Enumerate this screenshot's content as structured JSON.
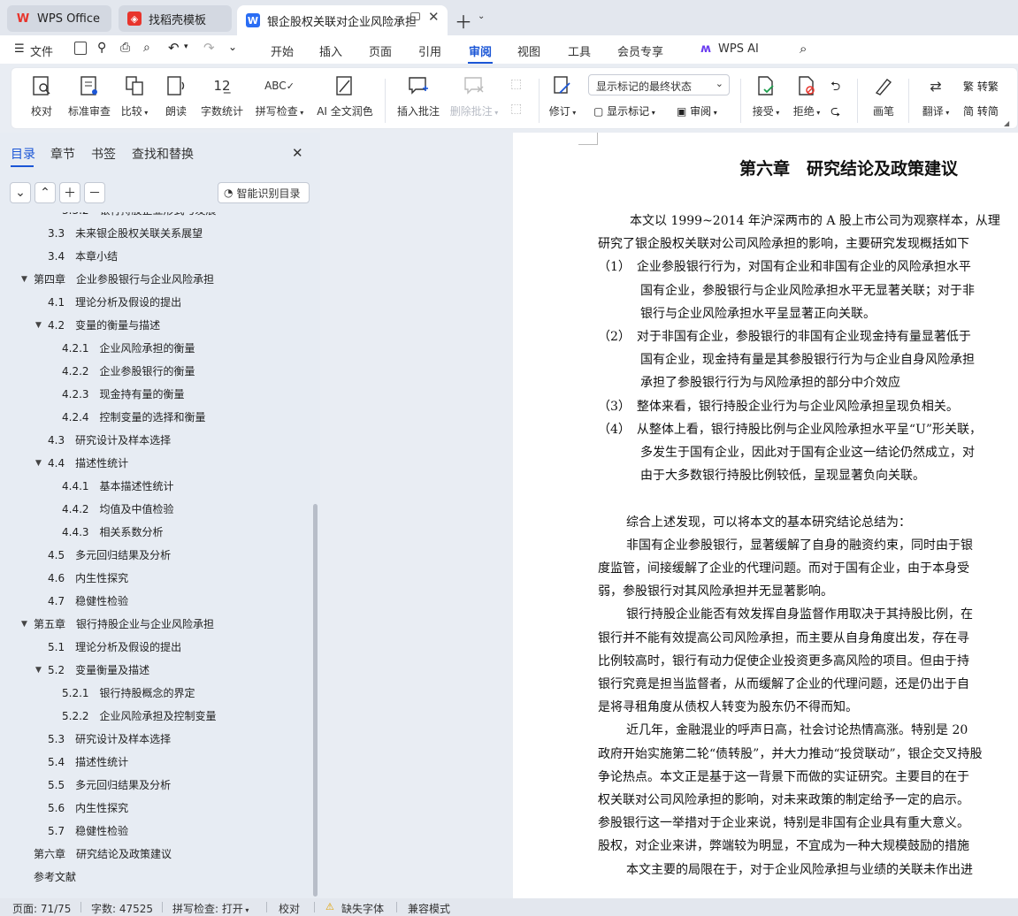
{
  "tabs": {
    "wps_office": "WPS Office",
    "template": "找稻壳模板",
    "document": "银企股权关联对企业风险承担"
  },
  "menu": {
    "file": "文件",
    "items": [
      "开始",
      "插入",
      "页面",
      "引用",
      "审阅",
      "视图",
      "工具",
      "会员专享",
      "WPS AI"
    ],
    "active": "审阅"
  },
  "ribbon": {
    "proofread": "校对",
    "standard_review": "标准审查",
    "compare": "比较",
    "read_aloud": "朗读",
    "word_count": "字数统计",
    "spell_check": "拼写检查",
    "ai_polish": "AI 全文润色",
    "insert_comment": "插入批注",
    "delete_comment": "删除批注",
    "track_changes": "修订",
    "markup_display_select": "显示标记的最终状态",
    "show_markup": "显示标记",
    "review": "审阅",
    "accept": "接受",
    "reject": "拒绝",
    "pen": "画笔",
    "translate": "翻译",
    "to_traditional": "转繁",
    "to_simplified": "转简"
  },
  "panel": {
    "tabs": [
      "目录",
      "章节",
      "书签",
      "查找和替换"
    ],
    "smart_toc": "智能识别目录"
  },
  "toc": [
    {
      "num": "3.3.2",
      "text": "银行持股企业形式与发展",
      "level": 3
    },
    {
      "num": "3.3",
      "text": "未来银企股权关联关系展望",
      "level": 2
    },
    {
      "num": "3.4",
      "text": "本章小结",
      "level": 2
    },
    {
      "num": "第四章",
      "text": "企业参股银行与企业风险承担",
      "level": 1,
      "expanded": true
    },
    {
      "num": "4.1",
      "text": "理论分析及假设的提出",
      "level": 2
    },
    {
      "num": "4.2",
      "text": "变量的衡量与描述",
      "level": 2,
      "expanded": true
    },
    {
      "num": "4.2.1",
      "text": "企业风险承担的衡量",
      "level": 3
    },
    {
      "num": "4.2.2",
      "text": "企业参股银行的衡量",
      "level": 3
    },
    {
      "num": "4.2.3",
      "text": "现金持有量的衡量",
      "level": 3
    },
    {
      "num": "4.2.4",
      "text": "控制变量的选择和衡量",
      "level": 3
    },
    {
      "num": "4.3",
      "text": "研究设计及样本选择",
      "level": 2
    },
    {
      "num": "4.4",
      "text": "描述性统计",
      "level": 2,
      "expanded": true
    },
    {
      "num": "4.4.1",
      "text": "基本描述性统计",
      "level": 3
    },
    {
      "num": "4.4.2",
      "text": "均值及中值检验",
      "level": 3
    },
    {
      "num": "4.4.3",
      "text": "相关系数分析",
      "level": 3
    },
    {
      "num": "4.5",
      "text": "多元回归结果及分析",
      "level": 2
    },
    {
      "num": "4.6",
      "text": "内生性探究",
      "level": 2
    },
    {
      "num": "4.7",
      "text": "稳健性检验",
      "level": 2
    },
    {
      "num": "第五章",
      "text": "银行持股企业与企业风险承担",
      "level": 1,
      "expanded": true
    },
    {
      "num": "5.1",
      "text": "理论分析及假设的提出",
      "level": 2
    },
    {
      "num": "5.2",
      "text": "变量衡量及描述",
      "level": 2,
      "expanded": true
    },
    {
      "num": "5.2.1",
      "text": "银行持股概念的界定",
      "level": 3
    },
    {
      "num": "5.2.2",
      "text": "企业风险承担及控制变量",
      "level": 3
    },
    {
      "num": "5.3",
      "text": "研究设计及样本选择",
      "level": 2
    },
    {
      "num": "5.4",
      "text": "描述性统计",
      "level": 2
    },
    {
      "num": "5.5",
      "text": "多元回归结果及分析",
      "level": 2
    },
    {
      "num": "5.6",
      "text": "内生性探究",
      "level": 2
    },
    {
      "num": "5.7",
      "text": "稳健性检验",
      "level": 2
    },
    {
      "num": "第六章",
      "text": "研究结论及政策建议",
      "level": 1
    },
    {
      "num": "参考文献",
      "text": "",
      "level": 1
    }
  ],
  "document": {
    "chapter_title": "第六章　研究结论及政策建议",
    "lines": [
      {
        "text": "本文以 1999~2014 年沪深两市的 A 股上市公司为观察样本，从理",
        "indent": 36
      },
      {
        "text": "研究了银企股权关联对公司风险承担的影响，主要研究发现概括如下",
        "indent": 0
      },
      {
        "text": "（1）　企业参股银行行为，对国有企业和非国有企业的风险承担水平",
        "indent": 0
      },
      {
        "text": "国有企业，参股银行与企业风险承担水平无显著关联；对于非",
        "indent": 48
      },
      {
        "text": "银行与企业风险承担水平呈显著正向关联。",
        "indent": 48
      },
      {
        "text": "（2）　对于非国有企业，参股银行的非国有企业现金持有量显著低于",
        "indent": 0
      },
      {
        "text": "国有企业，现金持有量是其参股银行行为与企业自身风险承担",
        "indent": 48
      },
      {
        "text": "承担了参股银行行为与风险承担的部分中介效应",
        "indent": 48
      },
      {
        "text": "（3）　整体来看，银行持股企业行为与企业风险承担呈现负相关。",
        "indent": 0
      },
      {
        "text": "（4）　从整体上看，银行持股比例与企业风险承担水平呈“U”形关联，",
        "indent": 0
      },
      {
        "text": "多发生于国有企业，因此对于国有企业这一结论仍然成立，对",
        "indent": 48
      },
      {
        "text": "由于大多数银行持股比例较低，呈现显著负向关联。",
        "indent": 48
      },
      {
        "text": "",
        "indent": 0
      },
      {
        "text": "综合上述发现，可以将本文的基本研究结论总结为：",
        "indent": 32
      },
      {
        "text": "非国有企业参股银行，显著缓解了自身的融资约束，同时由于银",
        "indent": 32
      },
      {
        "text": "度监管，间接缓解了企业的代理问题。而对于国有企业，由于本身受",
        "indent": 0
      },
      {
        "text": "弱，参股银行对其风险承担并无显著影响。",
        "indent": 0
      },
      {
        "text": "银行持股企业能否有效发挥自身监督作用取决于其持股比例，在",
        "indent": 32
      },
      {
        "text": "银行并不能有效提高公司风险承担，而主要从自身角度出发，存在寻",
        "indent": 0
      },
      {
        "text": "比例较高时，银行有动力促使企业投资更多高风险的项目。但由于持",
        "indent": 0
      },
      {
        "text": "银行究竟是担当监督者，从而缓解了企业的代理问题，还是仍出于自",
        "indent": 0
      },
      {
        "text": "是将寻租角度从债权人转变为股东仍不得而知。",
        "indent": 0
      },
      {
        "text": "近几年，金融混业的呼声日高，社会讨论热情高涨。特别是 20",
        "indent": 32
      },
      {
        "text": "政府开始实施第二轮“债转股”，并大力推动“投贷联动”，银企交叉持股",
        "indent": 0
      },
      {
        "text": "争论热点。本文正是基于这一背景下而做的实证研究。主要目的在于",
        "indent": 0
      },
      {
        "text": "权关联对公司风险承担的影响，对未来政策的制定给予一定的启示。",
        "indent": 0
      },
      {
        "text": "参股银行这一举措对于企业来说，特别是非国有企业具有重大意义。",
        "indent": 0
      },
      {
        "text": "股权，对企业来讲，弊端较为明显，不宜成为一种大规模鼓励的措施",
        "indent": 0
      },
      {
        "text": "本文主要的局限在于，对于企业风险承担与业绩的关联未作出进",
        "indent": 32
      }
    ]
  },
  "status": {
    "page": "页面: 71/75",
    "word_count": "字数: 47525",
    "spell_check": "拼写检查: 打开",
    "proofread": "校对",
    "missing_font": "缺失字体",
    "compat_mode": "兼容模式"
  },
  "colors": {
    "accent": "#1b56d6",
    "wps_red": "#e8342c",
    "word_blue": "#2a6df4"
  }
}
